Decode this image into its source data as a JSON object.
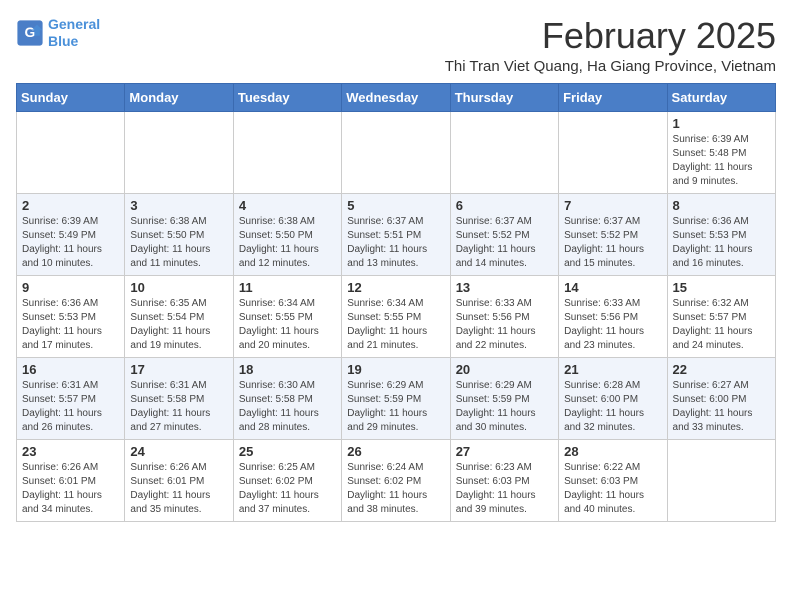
{
  "logo": {
    "line1": "General",
    "line2": "Blue"
  },
  "title": "February 2025",
  "subtitle": "Thi Tran Viet Quang, Ha Giang Province, Vietnam",
  "days_of_week": [
    "Sunday",
    "Monday",
    "Tuesday",
    "Wednesday",
    "Thursday",
    "Friday",
    "Saturday"
  ],
  "weeks": [
    [
      {
        "day": "",
        "info": ""
      },
      {
        "day": "",
        "info": ""
      },
      {
        "day": "",
        "info": ""
      },
      {
        "day": "",
        "info": ""
      },
      {
        "day": "",
        "info": ""
      },
      {
        "day": "",
        "info": ""
      },
      {
        "day": "1",
        "info": "Sunrise: 6:39 AM\nSunset: 5:48 PM\nDaylight: 11 hours and 9 minutes."
      }
    ],
    [
      {
        "day": "2",
        "info": "Sunrise: 6:39 AM\nSunset: 5:49 PM\nDaylight: 11 hours and 10 minutes."
      },
      {
        "day": "3",
        "info": "Sunrise: 6:38 AM\nSunset: 5:50 PM\nDaylight: 11 hours and 11 minutes."
      },
      {
        "day": "4",
        "info": "Sunrise: 6:38 AM\nSunset: 5:50 PM\nDaylight: 11 hours and 12 minutes."
      },
      {
        "day": "5",
        "info": "Sunrise: 6:37 AM\nSunset: 5:51 PM\nDaylight: 11 hours and 13 minutes."
      },
      {
        "day": "6",
        "info": "Sunrise: 6:37 AM\nSunset: 5:52 PM\nDaylight: 11 hours and 14 minutes."
      },
      {
        "day": "7",
        "info": "Sunrise: 6:37 AM\nSunset: 5:52 PM\nDaylight: 11 hours and 15 minutes."
      },
      {
        "day": "8",
        "info": "Sunrise: 6:36 AM\nSunset: 5:53 PM\nDaylight: 11 hours and 16 minutes."
      }
    ],
    [
      {
        "day": "9",
        "info": "Sunrise: 6:36 AM\nSunset: 5:53 PM\nDaylight: 11 hours and 17 minutes."
      },
      {
        "day": "10",
        "info": "Sunrise: 6:35 AM\nSunset: 5:54 PM\nDaylight: 11 hours and 19 minutes."
      },
      {
        "day": "11",
        "info": "Sunrise: 6:34 AM\nSunset: 5:55 PM\nDaylight: 11 hours and 20 minutes."
      },
      {
        "day": "12",
        "info": "Sunrise: 6:34 AM\nSunset: 5:55 PM\nDaylight: 11 hours and 21 minutes."
      },
      {
        "day": "13",
        "info": "Sunrise: 6:33 AM\nSunset: 5:56 PM\nDaylight: 11 hours and 22 minutes."
      },
      {
        "day": "14",
        "info": "Sunrise: 6:33 AM\nSunset: 5:56 PM\nDaylight: 11 hours and 23 minutes."
      },
      {
        "day": "15",
        "info": "Sunrise: 6:32 AM\nSunset: 5:57 PM\nDaylight: 11 hours and 24 minutes."
      }
    ],
    [
      {
        "day": "16",
        "info": "Sunrise: 6:31 AM\nSunset: 5:57 PM\nDaylight: 11 hours and 26 minutes."
      },
      {
        "day": "17",
        "info": "Sunrise: 6:31 AM\nSunset: 5:58 PM\nDaylight: 11 hours and 27 minutes."
      },
      {
        "day": "18",
        "info": "Sunrise: 6:30 AM\nSunset: 5:58 PM\nDaylight: 11 hours and 28 minutes."
      },
      {
        "day": "19",
        "info": "Sunrise: 6:29 AM\nSunset: 5:59 PM\nDaylight: 11 hours and 29 minutes."
      },
      {
        "day": "20",
        "info": "Sunrise: 6:29 AM\nSunset: 5:59 PM\nDaylight: 11 hours and 30 minutes."
      },
      {
        "day": "21",
        "info": "Sunrise: 6:28 AM\nSunset: 6:00 PM\nDaylight: 11 hours and 32 minutes."
      },
      {
        "day": "22",
        "info": "Sunrise: 6:27 AM\nSunset: 6:00 PM\nDaylight: 11 hours and 33 minutes."
      }
    ],
    [
      {
        "day": "23",
        "info": "Sunrise: 6:26 AM\nSunset: 6:01 PM\nDaylight: 11 hours and 34 minutes."
      },
      {
        "day": "24",
        "info": "Sunrise: 6:26 AM\nSunset: 6:01 PM\nDaylight: 11 hours and 35 minutes."
      },
      {
        "day": "25",
        "info": "Sunrise: 6:25 AM\nSunset: 6:02 PM\nDaylight: 11 hours and 37 minutes."
      },
      {
        "day": "26",
        "info": "Sunrise: 6:24 AM\nSunset: 6:02 PM\nDaylight: 11 hours and 38 minutes."
      },
      {
        "day": "27",
        "info": "Sunrise: 6:23 AM\nSunset: 6:03 PM\nDaylight: 11 hours and 39 minutes."
      },
      {
        "day": "28",
        "info": "Sunrise: 6:22 AM\nSunset: 6:03 PM\nDaylight: 11 hours and 40 minutes."
      },
      {
        "day": "",
        "info": ""
      }
    ]
  ]
}
